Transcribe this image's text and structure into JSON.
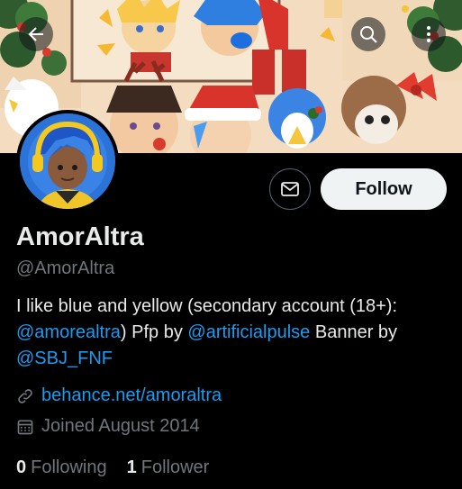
{
  "profile": {
    "display_name": "AmorAltra",
    "handle": "@AmorAltra",
    "bio": {
      "text1": "I like blue and yellow (secondary account (18+):",
      "mention1": "@amorealtra",
      "text2": ") Pfp by ",
      "mention2": "@artificialpulse",
      "text3": " Banner by",
      "mention3": "@SBJ_FNF"
    },
    "website": "behance.net/amoraltra",
    "joined": "Joined August 2014",
    "following_count": "0",
    "following_label": "Following",
    "followers_count": "1",
    "followers_label": "Follower"
  },
  "actions": {
    "follow_label": "Follow"
  },
  "icons": {
    "back": "arrow-left-icon",
    "search": "search-icon",
    "more": "more-vertical-icon",
    "message": "envelope-icon",
    "link": "link-icon",
    "calendar": "calendar-icon"
  },
  "colors": {
    "accent": "#1d9bf0",
    "background": "#000000",
    "muted": "#71767b",
    "follow_bg": "#eff3f4"
  }
}
